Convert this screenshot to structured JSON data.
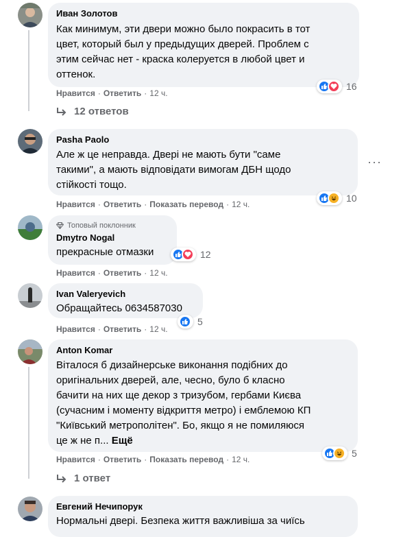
{
  "colors": {
    "text": "#050505",
    "secondary": "#65676b",
    "bubble": "#f0f2f5",
    "like": "#1877f2",
    "love": "#f33e58",
    "haha": "#f7b125"
  },
  "comments": [
    {
      "author": "Иван Золотов",
      "lines": [
        "Как минимум, эти двери можно было покрасить в тот",
        "цвет, который был у предыдущих дверей. Проблем с",
        "этим сейчас нет - краска колеруется в любой цвет и",
        "оттенок."
      ],
      "like": "Нравится",
      "reply": "Ответить",
      "time": "12 ч.",
      "reactions": [
        "like-icon",
        "love-icon"
      ],
      "reaction_count": "16"
    },
    {
      "author": "Pasha Paolo",
      "lines": [
        "Але ж це неправда. Двері не мають бути \"саме",
        "такими\", а мають відповідати вимогам ДБН щодо",
        "стійкості тощо."
      ],
      "like": "Нравится",
      "reply": "Ответить",
      "translate": "Показать перевод",
      "time": "12 ч.",
      "reactions": [
        "like-icon",
        "haha-icon"
      ],
      "reaction_count": "10"
    },
    {
      "badge": "Топовый поклонник",
      "author": "Dmytro Nogal",
      "lines": [
        "прекрасные отмазки"
      ],
      "like": "Нравится",
      "reply": "Ответить",
      "time": "12 ч.",
      "reactions": [
        "like-icon",
        "love-icon"
      ],
      "reaction_count": "12"
    },
    {
      "author": "Ivan Valeryevich",
      "lines": [
        "Обращайтесь 0634587030"
      ],
      "like": "Нравится",
      "reply": "Ответить",
      "time": "12 ч.",
      "reactions": [
        "like-icon"
      ],
      "reaction_count": "5"
    },
    {
      "author": "Anton Komar",
      "lines": [
        "Віталося б дизайнерське виконання подібних до",
        "оригінальних дверей, але, чесно, було б класно",
        "бачити на них ще декор з тризубом, гербами Києва",
        "(сучасним і моменту відкриття метро) і емблемою КП",
        "\"Київський метрополітен\". Бо, якщо я не помиляюся",
        "це ж не п..."
      ],
      "see_more": "Ещё",
      "like": "Нравится",
      "reply": "Ответить",
      "translate": "Показать перевод",
      "time": "12 ч.",
      "reactions": [
        "like-icon",
        "haha-icon"
      ],
      "reaction_count": "5"
    },
    {
      "author": "Евгений Нечипорук",
      "lines": [
        "Нормальні двері. Безпека життя важливіша за чиїсь"
      ]
    }
  ],
  "replies_link_1": "12 ответов",
  "replies_link_2": "1 ответ",
  "more_options": "···"
}
